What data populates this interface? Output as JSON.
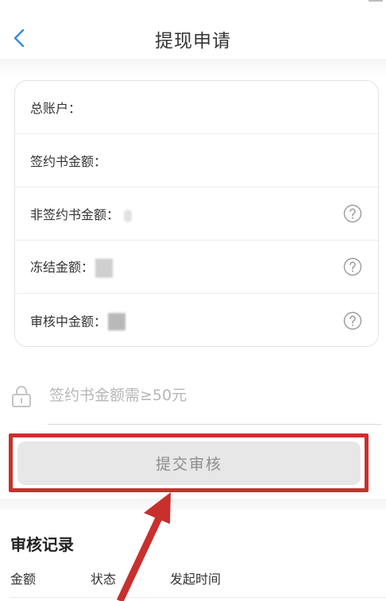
{
  "header": {
    "title": "提现申请"
  },
  "account_info": {
    "rows": [
      {
        "label": "总账户：",
        "has_help": false
      },
      {
        "label": "签约书金额：",
        "has_help": false
      },
      {
        "label": "非签约书金额：",
        "has_help": true
      },
      {
        "label": "冻结金额：",
        "has_help": true
      },
      {
        "label": "审核中金额：",
        "has_help": true
      }
    ],
    "help_icon": "question-circle-icon"
  },
  "withdraw": {
    "amount_placeholder": "签约书金额需≥50元",
    "lock_icon": "lock-icon"
  },
  "submit": {
    "label": "提交审核"
  },
  "records": {
    "title": "审核记录",
    "columns": [
      "金额",
      "状态",
      "发起时间"
    ]
  },
  "colors": {
    "accent": "#3a8de0",
    "annotation_red": "#c8302e",
    "button_bg": "#e7e7e7",
    "placeholder_text": "#b7b7b7"
  }
}
